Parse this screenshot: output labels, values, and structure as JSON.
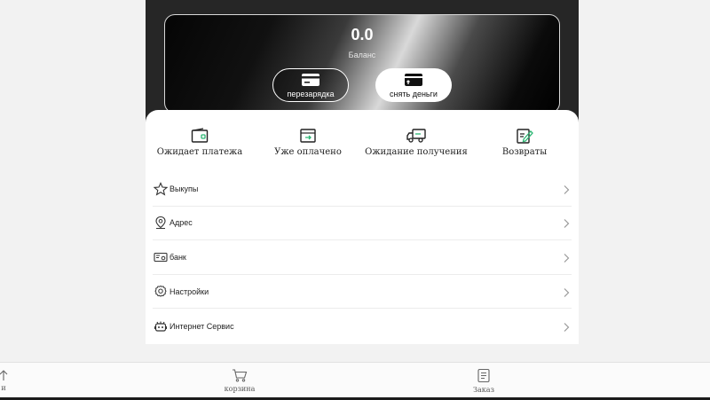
{
  "balance": {
    "amount": "0.0",
    "label": "Баланс",
    "recharge_label": "перезарядка",
    "withdraw_label": "снять деньги"
  },
  "orders": [
    {
      "label": "Ожидает платежа",
      "icon": "wallet-icon"
    },
    {
      "label": "Уже оплачено",
      "icon": "paid-box-icon"
    },
    {
      "label": "Ожидание получения",
      "icon": "delivery-truck-icon"
    },
    {
      "label": "Возвраты",
      "icon": "return-edit-icon"
    }
  ],
  "menu": [
    {
      "label": "Выкупы",
      "icon": "star-icon"
    },
    {
      "label": "Адрес",
      "icon": "location-pin-icon"
    },
    {
      "label": "банк",
      "icon": "bank-card-icon"
    },
    {
      "label": "Настройки",
      "icon": "gear-icon"
    },
    {
      "label": "Интернет Сервис",
      "icon": "robot-service-icon"
    }
  ],
  "tabbar": {
    "left_label": "и",
    "cart_label": "корзина",
    "order_label": "Заказ"
  },
  "colors": {
    "accent_green": "#2bb673",
    "text_dark": "#222222"
  }
}
